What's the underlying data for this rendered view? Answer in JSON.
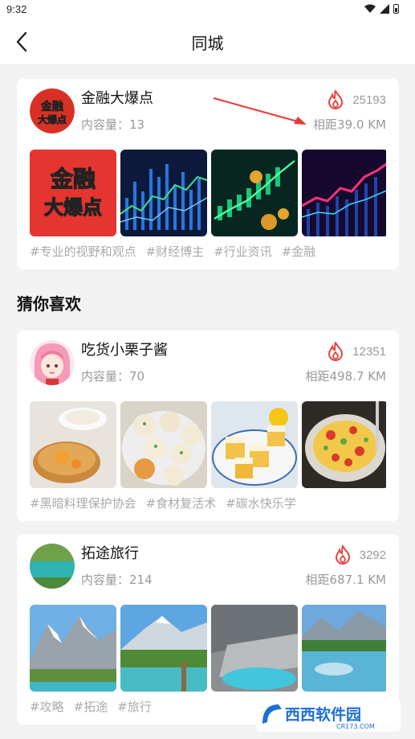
{
  "status_bar": {
    "time": "9:32"
  },
  "header": {
    "title": "同城"
  },
  "featured": {
    "name": "金融大爆点",
    "content_count": "内容量：13",
    "hot": "25193",
    "distance": "相距39.0 KM",
    "avatar_text": "金融大爆点",
    "thumb1_text_top": "金融",
    "thumb1_text_bottom": "大爆点",
    "tags": [
      "#专业的视野和观点",
      "#财经博主",
      "#行业资讯",
      "#金融"
    ]
  },
  "section": {
    "title": "猜你喜欢"
  },
  "recommend": [
    {
      "name": "吃货小栗子酱",
      "content_count": "内容量：70",
      "hot": "12351",
      "distance": "相距498.7 KM",
      "tags": [
        "#黑暗料理保护协会",
        "#食材复活术",
        "#碳水快乐学"
      ]
    },
    {
      "name": "拓途旅行",
      "content_count": "内容量：214",
      "hot": "3292",
      "distance": "相距687.1 KM",
      "tags": [
        "#攻略",
        "#拓途",
        "#旅行"
      ]
    }
  ],
  "watermark": {
    "brand": "西西软件园",
    "url": "CR173.COM"
  },
  "colors": {
    "flame": "#e8413a",
    "accent_red": "#e53935",
    "arrow": "#e53935"
  }
}
